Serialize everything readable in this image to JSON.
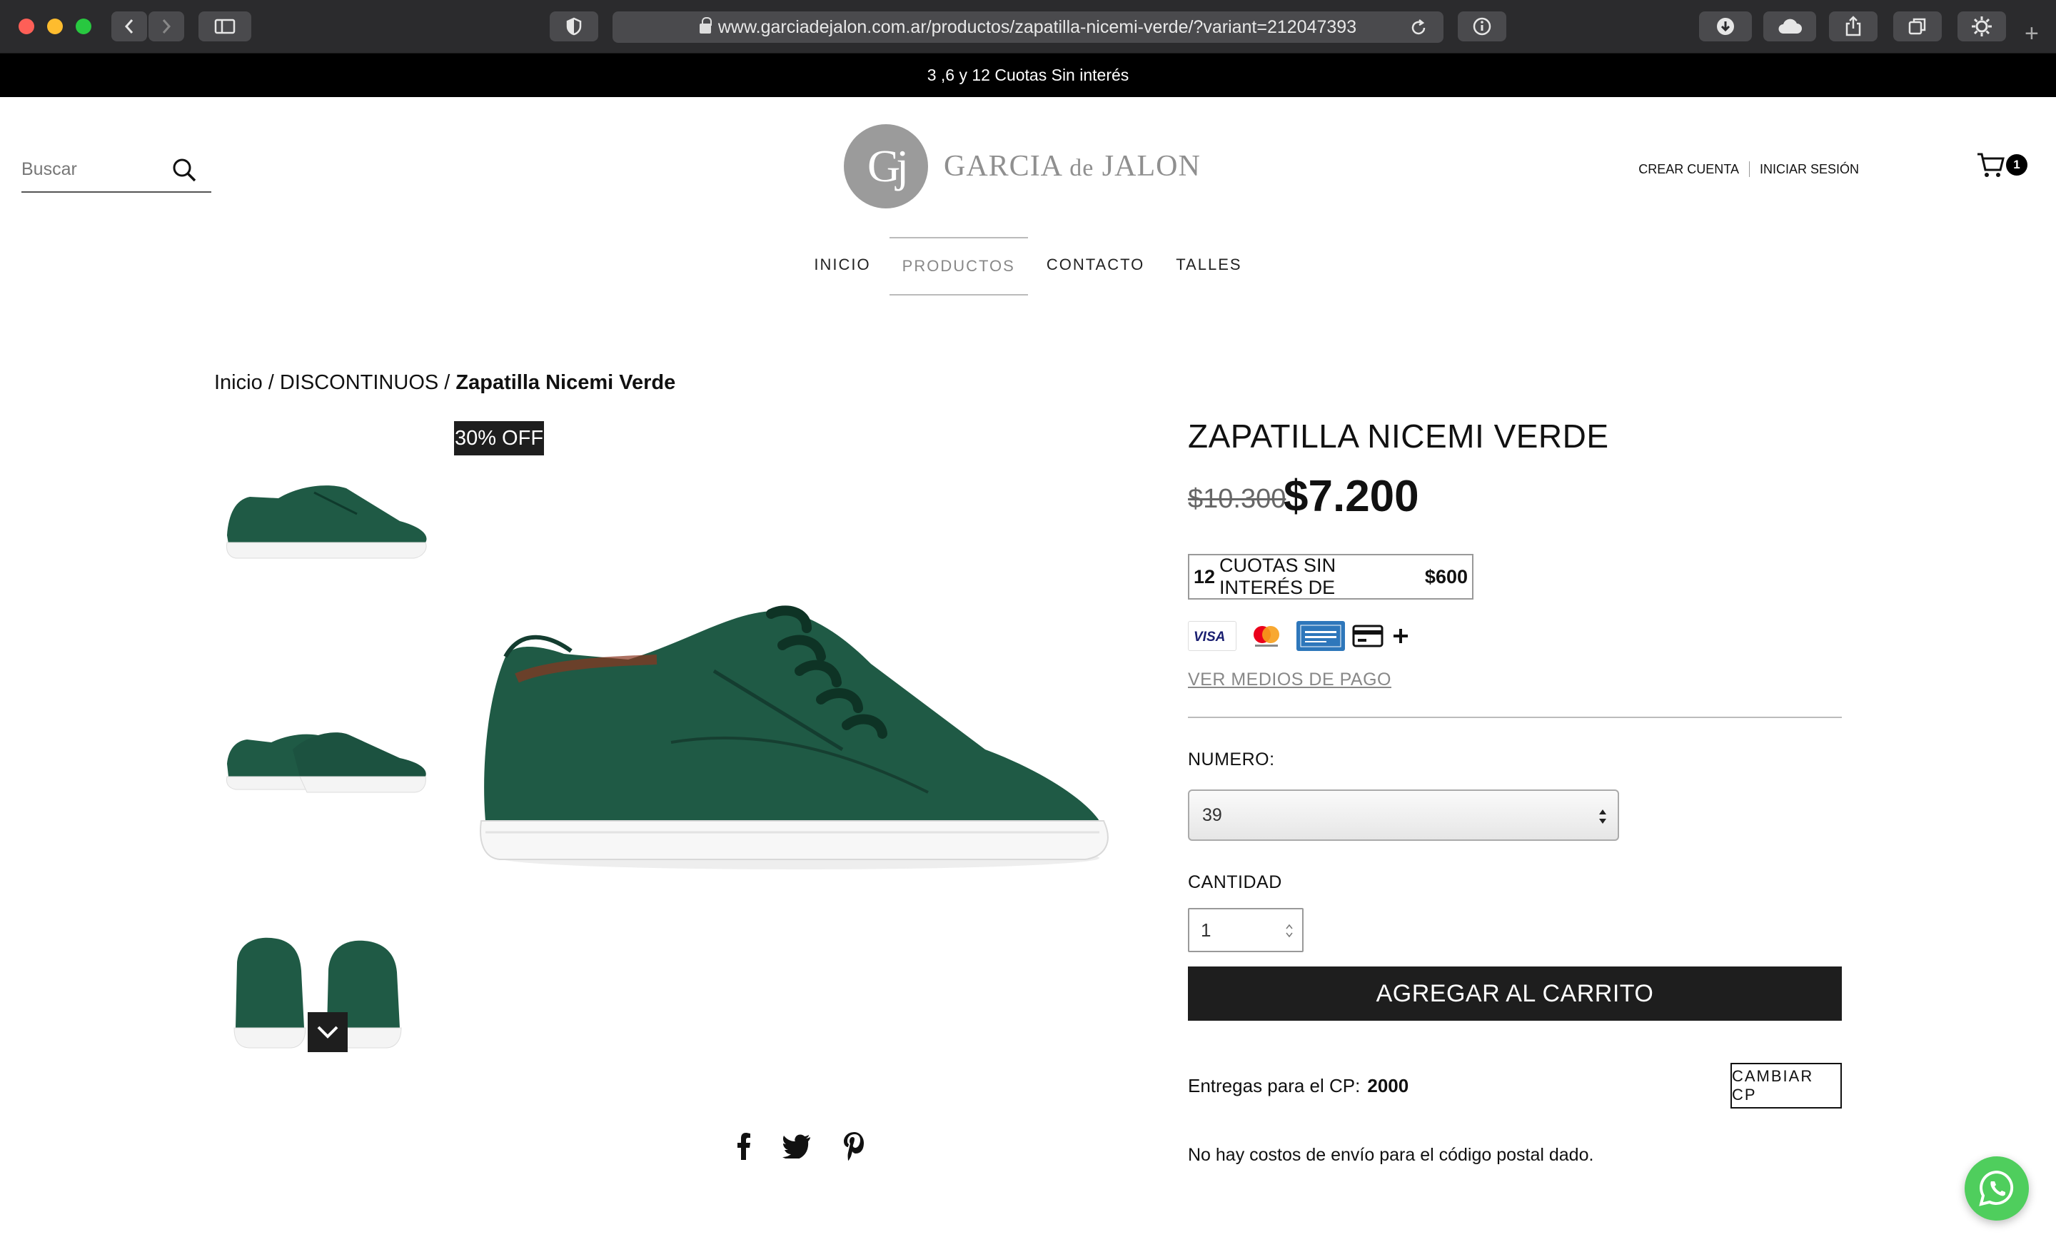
{
  "browser": {
    "url": "www.garciadejalon.com.ar/productos/zapatilla-nicemi-verde/?variant=212047393"
  },
  "announcement": "3 ,6 y 12 Cuotas Sin interés",
  "header": {
    "search_placeholder": "Buscar",
    "logo_monogram": "Gj",
    "logo_name_1": "GARCIA ",
    "logo_name_2": "de",
    "logo_name_3": " JALON",
    "create_account": "CREAR CUENTA",
    "login": "INICIAR SESIÓN",
    "cart_count": "1"
  },
  "nav": [
    "INICIO",
    "PRODUCTOS",
    "CONTACTO",
    "TALLES"
  ],
  "breadcrumb": {
    "home": "Inicio",
    "sep": " / ",
    "category": "DISCONTINUOS",
    "current": "Zapatilla Nicemi Verde"
  },
  "gallery": {
    "badge": "30% OFF"
  },
  "product": {
    "title": "ZAPATILLA NICEMI VERDE",
    "old_price": "$10.300",
    "price": "$7.200",
    "installments_count": "12",
    "installments_text": "CUOTAS SIN INTERÉS DE",
    "installments_amount": "$600",
    "payment_link": "VER MEDIOS DE PAGO",
    "size_label": "NUMERO:",
    "size_value": "39",
    "qty_label": "CANTIDAD",
    "qty_value": "1",
    "add_to_cart": "AGREGAR AL CARRITO",
    "delivery_label": "Entregas para el CP:",
    "delivery_cp": "2000",
    "change_cp": "CAMBIAR CP",
    "shipping_note": "No hay costos de envío para el código postal dado."
  },
  "payment_icons": [
    "visa-icon",
    "mastercard-icon",
    "amex-icon",
    "card-icon",
    "plus-icon"
  ],
  "colors": {
    "shoe_green": "#1f5a45",
    "dark": "#1e1e1e",
    "whatsapp": "#4fce5d"
  }
}
